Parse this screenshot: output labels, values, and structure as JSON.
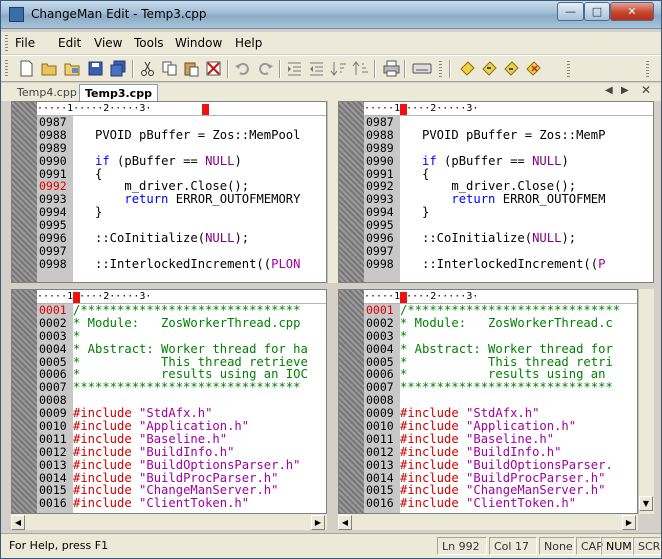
{
  "window": {
    "title": "ChangeMan Edit - Temp3.cpp"
  },
  "menu": {
    "items": [
      "File",
      "Edit",
      "View",
      "Tools",
      "Window",
      "Help"
    ]
  },
  "tabs": [
    {
      "label": "Temp4.cpp"
    },
    {
      "label": "Temp3.cpp"
    }
  ],
  "top_pane": {
    "ruler": "·····1·····2·····3·",
    "line_numbers": [
      "0987",
      "0988",
      "0989",
      "0990",
      "0991",
      "0992",
      "0993",
      "0994",
      "0995",
      "0996",
      "0997",
      "0998"
    ],
    "highlight_line": "0992"
  },
  "bottom_pane": {
    "ruler": "·····1·····2·····3·",
    "line_numbers": [
      "0001",
      "0002",
      "0003",
      "0004",
      "0005",
      "0006",
      "0007",
      "0008",
      "0009",
      "0010",
      "0011",
      "0012",
      "0013",
      "0014",
      "0015",
      "0016"
    ],
    "highlight_line": "0001"
  },
  "code_top_left": [
    "",
    "   PVOID pBuffer = Zos::MemPool",
    "",
    "   if (pBuffer == NULL)",
    "   {",
    "       m_driver.Close();",
    "       return ERROR_OUTOFMEMORY",
    "   }",
    "",
    "   ::CoInitialize(NULL);",
    "",
    "   ::InterlockedIncrement((PLON"
  ],
  "code_top_right": [
    "",
    "   PVOID pBuffer = Zos::MemP",
    "",
    "   if (pBuffer == NULL)",
    "   {",
    "       m_driver.Close();",
    "       return ERROR_OUTOFMEM",
    "   }",
    "",
    "   ::CoInitialize(NULL);",
    "",
    "   ::InterlockedIncrement((P"
  ],
  "code_bottom_left": [
    "/******************************",
    "* Module:   ZosWorkerThread.cpp",
    "*",
    "* Abstract: Worker thread for ha",
    "*           This thread retrieve",
    "*           results using an IOC",
    "*******************************",
    "",
    "#include \"StdAfx.h\"",
    "#include \"Application.h\"",
    "#include \"Baseline.h\"",
    "#include \"BuildInfo.h\"",
    "#include \"BuildOptionsParser.h\"",
    "#include \"BuildProcParser.h\"",
    "#include \"ChangeManServer.h\"",
    "#include \"ClientToken.h\""
  ],
  "code_bottom_right": [
    "/*****************************",
    "* Module:   ZosWorkerThread.c",
    "*",
    "* Abstract: Worker thread for",
    "*           This thread retri",
    "*           results using an",
    "*****************************",
    "",
    "#include \"StdAfx.h\"",
    "#include \"Application.h\"",
    "#include \"Baseline.h\"",
    "#include \"BuildInfo.h\"",
    "#include \"BuildOptionsParser.",
    "#include \"BuildProcParser.h\"",
    "#include \"ChangeManServer.h\"",
    "#include \"ClientToken.h\""
  ],
  "status": {
    "help": "For Help, press F1",
    "line": "Ln 992",
    "col": "Col 17",
    "mode": "None",
    "caps": "CAP",
    "num": "NUM",
    "scroll": "SCRL"
  },
  "colors": {
    "keyword": "#0000ff",
    "preprocessor": "#d00000",
    "string": "#a000a0",
    "comment": "#008000",
    "ruler_mark": "#ee1111"
  }
}
